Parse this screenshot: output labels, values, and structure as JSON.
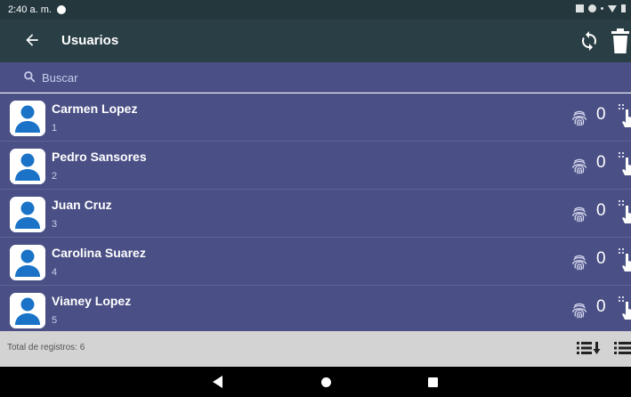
{
  "status_bar": {
    "time": "2:40 a. m.",
    "icons": [
      "clock-icon",
      "screenshot-icon",
      "location-icon",
      "dot-icon",
      "wifi-icon",
      "battery-icon"
    ]
  },
  "app_bar": {
    "title": "Usuarios",
    "icons": [
      "back-arrow-icon",
      "sync-icon",
      "trash-icon"
    ]
  },
  "search": {
    "placeholder": "Buscar",
    "value": ""
  },
  "users": [
    {
      "name": "Carmen Lopez",
      "id": "1",
      "fingerprints": "0"
    },
    {
      "name": "Pedro Sansores",
      "id": "2",
      "fingerprints": "0"
    },
    {
      "name": "Juan Cruz",
      "id": "3",
      "fingerprints": "0"
    },
    {
      "name": "Carolina Suarez",
      "id": "4",
      "fingerprints": "0"
    },
    {
      "name": "Vianey Lopez",
      "id": "5",
      "fingerprints": "0"
    }
  ],
  "footer": {
    "total_text": "Total de registros: 6",
    "icons": [
      "sort-list-icon",
      "list-menu-icon"
    ]
  },
  "nav_bar": {
    "icons": [
      "nav-back-icon",
      "nav-home-icon",
      "nav-recents-icon"
    ]
  },
  "colors": {
    "status_bar": "#23373d",
    "app_bar": "#2a3f45",
    "list_background": "#4a4f85",
    "avatar_blue": "#1a73c7",
    "footer": "#d3d3d3",
    "nav_bar": "#000000"
  }
}
